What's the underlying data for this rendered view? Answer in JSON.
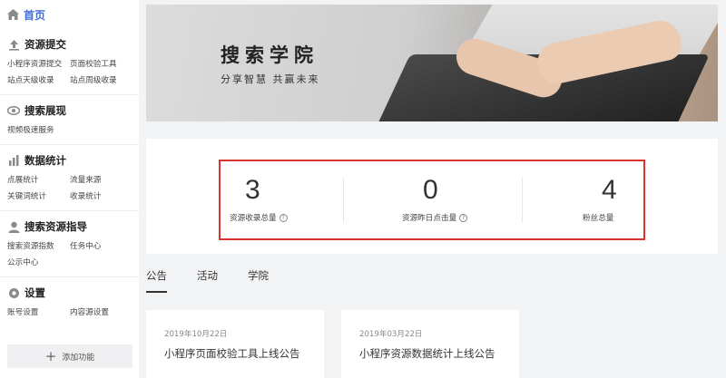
{
  "sidebar": {
    "home": "首页",
    "sections": [
      {
        "title": "资源提交",
        "icon": "upload-icon",
        "links": [
          "小程序资源提交",
          "页面校验工具",
          "站点天级收录",
          "站点周级收录"
        ]
      },
      {
        "title": "搜索展现",
        "icon": "eye-icon",
        "links": [
          "视频极速服务"
        ]
      },
      {
        "title": "数据统计",
        "icon": "bar-chart-icon",
        "links": [
          "点展统计",
          "流量来源",
          "关键词统计",
          "收录统计"
        ]
      },
      {
        "title": "搜索资源指导",
        "icon": "person-icon",
        "links": [
          "搜索资源指数",
          "任务中心",
          "公示中心"
        ]
      },
      {
        "title": "设置",
        "icon": "gear-icon",
        "links": [
          "账号设置",
          "内容源设置"
        ]
      }
    ],
    "add_label": "添加功能"
  },
  "banner": {
    "title": "搜索学院",
    "subtitle": "分享智慧  共赢未来"
  },
  "stats": [
    {
      "value": "3",
      "label": "资源收录总量"
    },
    {
      "value": "0",
      "label": "资源昨日点击量"
    },
    {
      "value": "4",
      "label": "粉丝总量"
    }
  ],
  "tabs": [
    "公告",
    "活动",
    "学院"
  ],
  "notices": [
    {
      "date": "2019年10月22日",
      "title": "小程序页面校验工具上线公告"
    },
    {
      "date": "2019年03月22日",
      "title": "小程序资源数据统计上线公告"
    }
  ],
  "colors": {
    "accent": "#3f6cd9",
    "highlight_border": "#d8342c"
  }
}
